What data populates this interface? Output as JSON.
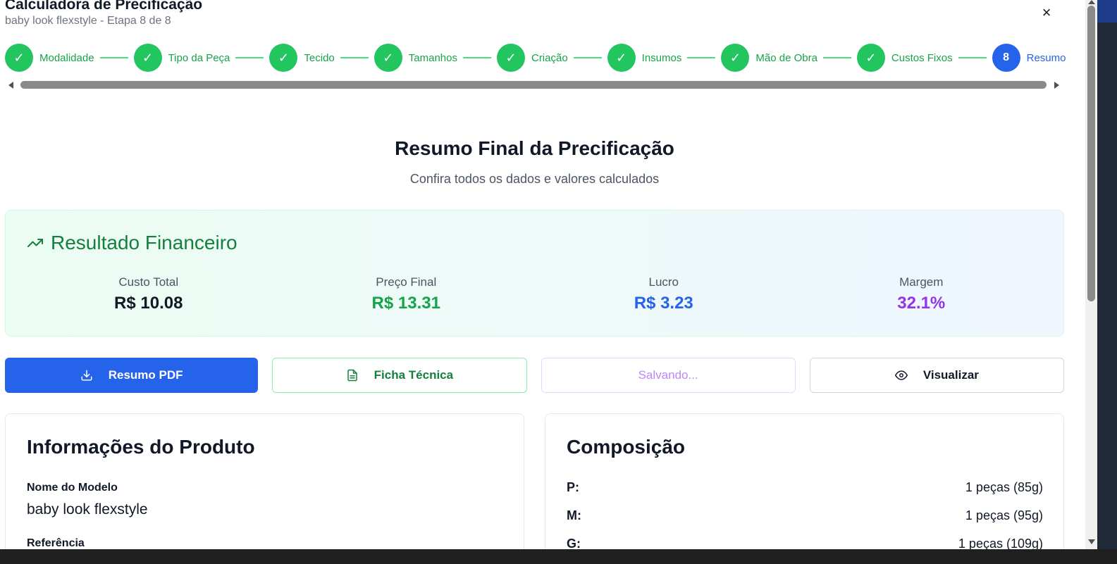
{
  "header": {
    "title": "Calculadora de Precificação",
    "subtitle": "baby look flexstyle - Etapa 8 de 8",
    "close_glyph": "×"
  },
  "stepper": {
    "steps": [
      {
        "label": "Modalidade",
        "mark": "✓",
        "status": "done"
      },
      {
        "label": "Tipo da Peça",
        "mark": "✓",
        "status": "done"
      },
      {
        "label": "Tecido",
        "mark": "✓",
        "status": "done"
      },
      {
        "label": "Tamanhos",
        "mark": "✓",
        "status": "done"
      },
      {
        "label": "Criação",
        "mark": "✓",
        "status": "done"
      },
      {
        "label": "Insumos",
        "mark": "✓",
        "status": "done"
      },
      {
        "label": "Mão de Obra",
        "mark": "✓",
        "status": "done"
      },
      {
        "label": "Custos Fixos",
        "mark": "✓",
        "status": "done"
      },
      {
        "label": "Resumo",
        "mark": "8",
        "status": "current"
      }
    ]
  },
  "summary": {
    "title": "Resumo Final da Precificação",
    "subtitle": "Confira todos os dados e valores calculados"
  },
  "financial": {
    "title": "Resultado Financeiro",
    "icon": "trending-up-icon",
    "metrics": {
      "custo_total": {
        "label": "Custo Total",
        "value": "R$ 10.08",
        "color": "#111827"
      },
      "preco_final": {
        "label": "Preço Final",
        "value": "R$ 13.31",
        "color": "#16a34a"
      },
      "lucro": {
        "label": "Lucro",
        "value": "R$ 3.23",
        "color": "#2563eb"
      },
      "margem": {
        "label": "Margem",
        "value": "32.1%",
        "color": "#9333ea"
      }
    }
  },
  "actions": {
    "pdf_label": "Resumo PDF",
    "ficha_label": "Ficha Técnica",
    "save_label": "Salvando...",
    "view_label": "Visualizar"
  },
  "product_info": {
    "title": "Informações do Produto",
    "model_label": "Nome do Modelo",
    "model_value": "baby look flexstyle",
    "ref_label": "Referência"
  },
  "composition": {
    "title": "Composição",
    "rows": [
      {
        "size": "P:",
        "value": "1 peças (85g)"
      },
      {
        "size": "M:",
        "value": "1 peças (95g)"
      },
      {
        "size": "G:",
        "value": "1 peças (109g)"
      }
    ]
  },
  "colors": {
    "brand_blue": "#2563eb",
    "success_green": "#22c55e",
    "margin_purple": "#9333ea"
  }
}
